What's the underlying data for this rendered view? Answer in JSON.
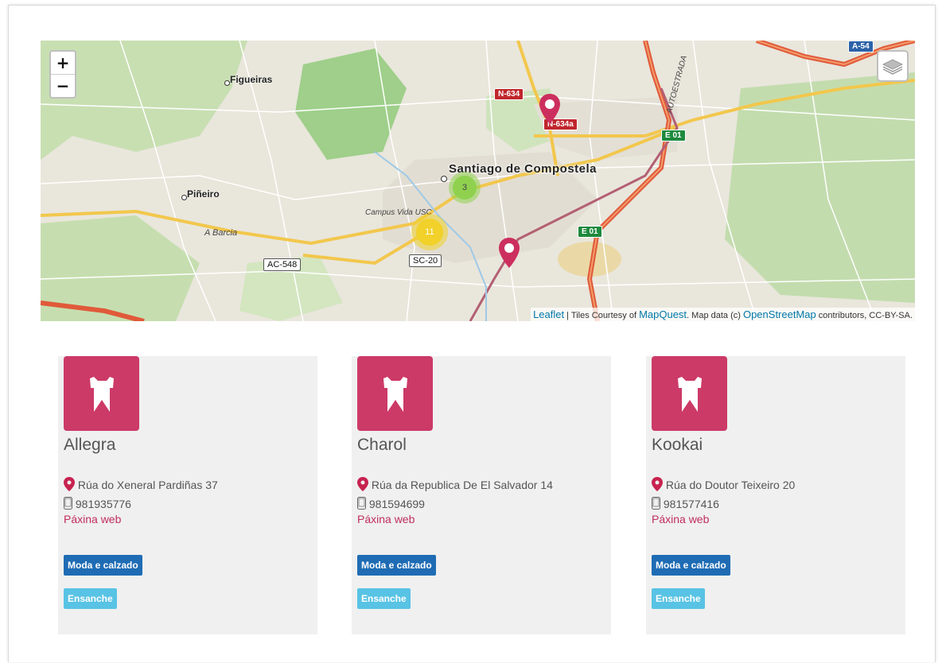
{
  "map": {
    "zoom_in": "+",
    "zoom_out": "−",
    "layers_icon": "layers-icon",
    "labels": {
      "city": "Santiago de Compostela",
      "figueiras": "Figueiras",
      "pineiro": "Piñeiro",
      "campus": "Campus Vida USC",
      "abarcia": "A Barcia",
      "autoestrada": "AUTOESTRADA"
    },
    "shields": {
      "n634": "N-634",
      "n634a": "N-634a",
      "e01_top": "E 01",
      "e01_mid": "E 01",
      "a54": "A-54",
      "ac548": "AC-548",
      "sc20": "SC-20"
    },
    "clusters": [
      {
        "count": "3",
        "color": "#8fd14f"
      },
      {
        "count": "11",
        "color": "#f1d12a"
      }
    ],
    "attribution": {
      "leaflet": "Leaflet",
      "sep": " | Tiles Courtesy of ",
      "mapquest": "MapQuest",
      "mid": ". Map data (c) ",
      "osm": "OpenStreetMap",
      "end": " contributors, CC-BY-SA."
    }
  },
  "stores": [
    {
      "name": "Allegra",
      "address": "Rúa do Xeneral Pardiñas 37",
      "phone": "981935776",
      "web": "Páxina web",
      "category": "Moda e calzado",
      "area": "Ensanche"
    },
    {
      "name": "Charol",
      "address": "Rúa da Republica De El Salvador 14",
      "phone": "981594699",
      "web": "Páxina web",
      "category": "Moda e calzado",
      "area": "Ensanche"
    },
    {
      "name": "Kookai",
      "address": "Rúa do Doutor Teixeiro 20",
      "phone": "981577416",
      "web": "Páxina web",
      "category": "Moda e calzado",
      "area": "Ensanche"
    }
  ],
  "colors": {
    "accent": "#cc3a67",
    "primary_button": "#1f6cb4",
    "info_button": "#58c3e4",
    "link": "#c02f5c"
  }
}
